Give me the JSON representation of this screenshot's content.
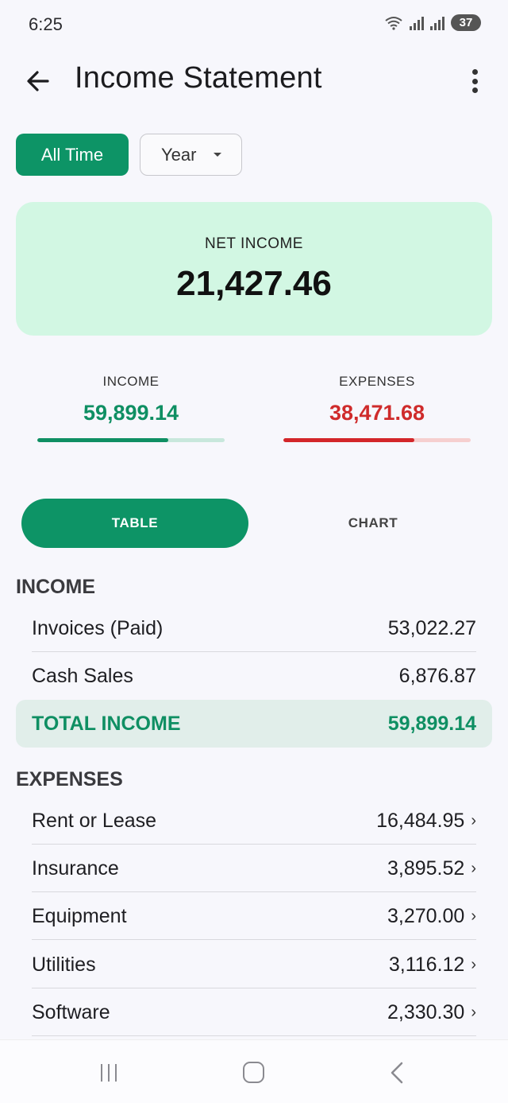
{
  "status": {
    "time": "6:25",
    "battery": "37"
  },
  "header": {
    "title": "Income Statement"
  },
  "filter": {
    "primary": "All Time",
    "period": "Year"
  },
  "net_income": {
    "label": "NET INCOME",
    "value": "21,427.46"
  },
  "summary": {
    "income": {
      "label": "INCOME",
      "value": "59,899.14",
      "progress": 0.7
    },
    "expenses": {
      "label": "EXPENSES",
      "value": "38,471.68",
      "progress": 0.7
    }
  },
  "tabs": {
    "table": "TABLE",
    "chart": "CHART"
  },
  "income_section": {
    "title": "INCOME",
    "rows": [
      {
        "label": "Invoices (Paid)",
        "value": "53,022.27"
      },
      {
        "label": "Cash Sales",
        "value": "6,876.87"
      }
    ],
    "total": {
      "label": "TOTAL INCOME",
      "value": "59,899.14"
    }
  },
  "expenses_section": {
    "title": "EXPENSES",
    "rows": [
      {
        "label": "Rent or Lease",
        "value": "16,484.95"
      },
      {
        "label": "Insurance",
        "value": "3,895.52"
      },
      {
        "label": "Equipment",
        "value": "3,270.00"
      },
      {
        "label": "Utilities",
        "value": "3,116.12"
      },
      {
        "label": "Software",
        "value": "2,330.30"
      }
    ]
  },
  "colors": {
    "accent": "#0d9466",
    "income": "#0f8f63",
    "expense": "#cf2b2b",
    "card": "#d2f7e3"
  },
  "icons": [
    "back-arrow-icon",
    "more-vert-icon",
    "dropdown-caret-icon",
    "chevron-right-icon",
    "wifi-icon",
    "signal-icon",
    "battery-icon"
  ]
}
